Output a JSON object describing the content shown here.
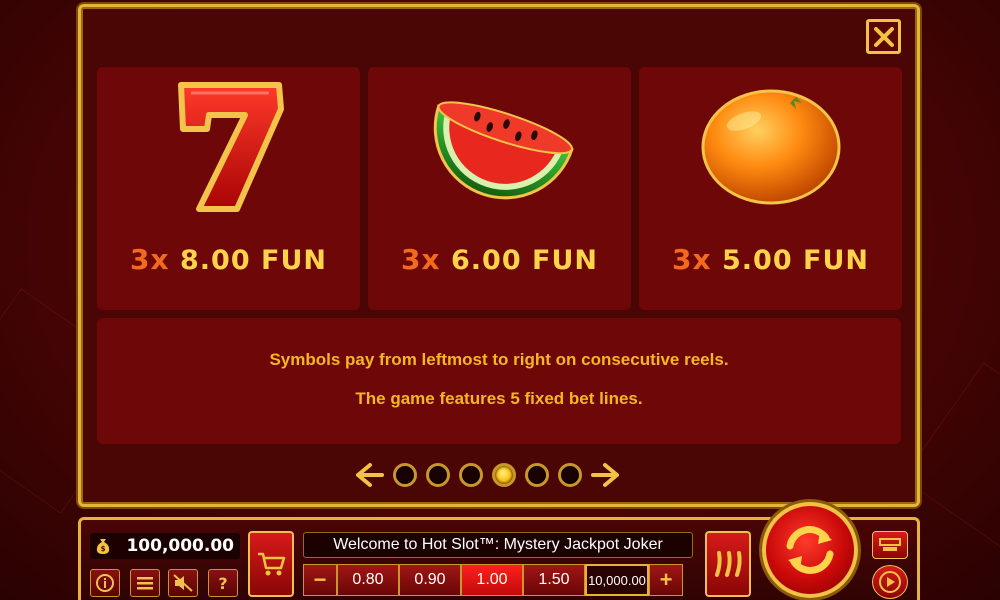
{
  "paytable": {
    "cards": [
      {
        "symbol": "seven-icon",
        "multiplier": "3x",
        "amount": "8.00 FUN"
      },
      {
        "symbol": "watermelon-icon",
        "multiplier": "3x",
        "amount": "6.00 FUN"
      },
      {
        "symbol": "orange-icon",
        "multiplier": "3x",
        "amount": "5.00 FUN"
      }
    ],
    "rules": [
      "Symbols pay from leftmost to right on consecutive reels.",
      "The game features 5 fixed bet lines."
    ],
    "pages": 6,
    "active_page": 4
  },
  "bar": {
    "balance": "100,000.00",
    "message": "Welcome to Hot Slot™: Mystery Jackpot Joker",
    "bets": [
      "0.80",
      "0.90",
      "1.00",
      "1.50"
    ],
    "selected_bet": "1.00",
    "max_bet": "10,000.00",
    "minus": "−",
    "plus": "+",
    "help": "?"
  },
  "colors": {
    "gold": "#e7b43a",
    "payout": "#ffd34a",
    "multiplier": "#f26a1e",
    "rules": "#f5b622"
  }
}
